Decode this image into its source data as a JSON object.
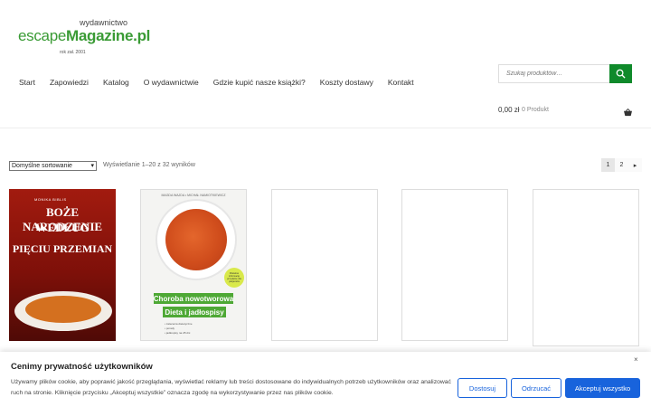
{
  "logo": {
    "top": "wydawnictwo",
    "escape": "escape",
    "magazine": "Magazine.pl",
    "since": "rok zał. 2001"
  },
  "nav": [
    "Start",
    "Zapowiedzi",
    "Katalog",
    "O wydawnictwie",
    "Gdzie kupić nasze książki?",
    "Koszty dostawy",
    "Kontakt"
  ],
  "search": {
    "placeholder": "Szukaj produktów…"
  },
  "cart": {
    "total": "0,00 zł",
    "count": "0 Produkt"
  },
  "shop": {
    "sort_selected": "Domyślne sortowanie",
    "result_count": "Wyświetlanie 1–20 z 32 wyników",
    "pages": [
      "1",
      "2"
    ],
    "next": "→"
  },
  "products": [
    {
      "author": "MONIKA BIBLIS",
      "title_lines": [
        "BOŻE NARODZENIE",
        "WEDŁUG",
        "PIĘCIU PRZEMIAN"
      ]
    },
    {
      "authors": "MAGDA WAJDA • MICHAŁ NAMIOTKIEWICZ",
      "title_lines": [
        "Choroba nowotworowa",
        "Dieta i jadłospisy"
      ],
      "bullets": [
        "• zalecenia dietetyczne",
        "• porady",
        "• jadłospisy na 28 dni"
      ],
      "badge": "Rzetelne informacje przydatne dla pacjentów"
    },
    {},
    {},
    {}
  ],
  "cookie": {
    "title": "Cenimy prywatność użytkowników",
    "text": "Używamy plików cookie, aby poprawić jakość przeglądania, wyświetlać reklamy lub treści dostosowane do indywidualnych potrzeb użytkowników oraz analizować ruch na stronie. Kliknięcie przycisku „Akceptuj wszystkie” oznacza zgodę na wykorzystywanie przez nas plików cookie.",
    "customize": "Dostosuj",
    "reject": "Odrzucać",
    "accept": "Akceptuj wszystko",
    "close": "×"
  },
  "colors": {
    "brand_green": "#0f8a2b",
    "cookie_blue": "#1863dc"
  },
  "icons": {
    "search": "search-icon",
    "cart": "basket-icon",
    "close": "close-icon"
  }
}
